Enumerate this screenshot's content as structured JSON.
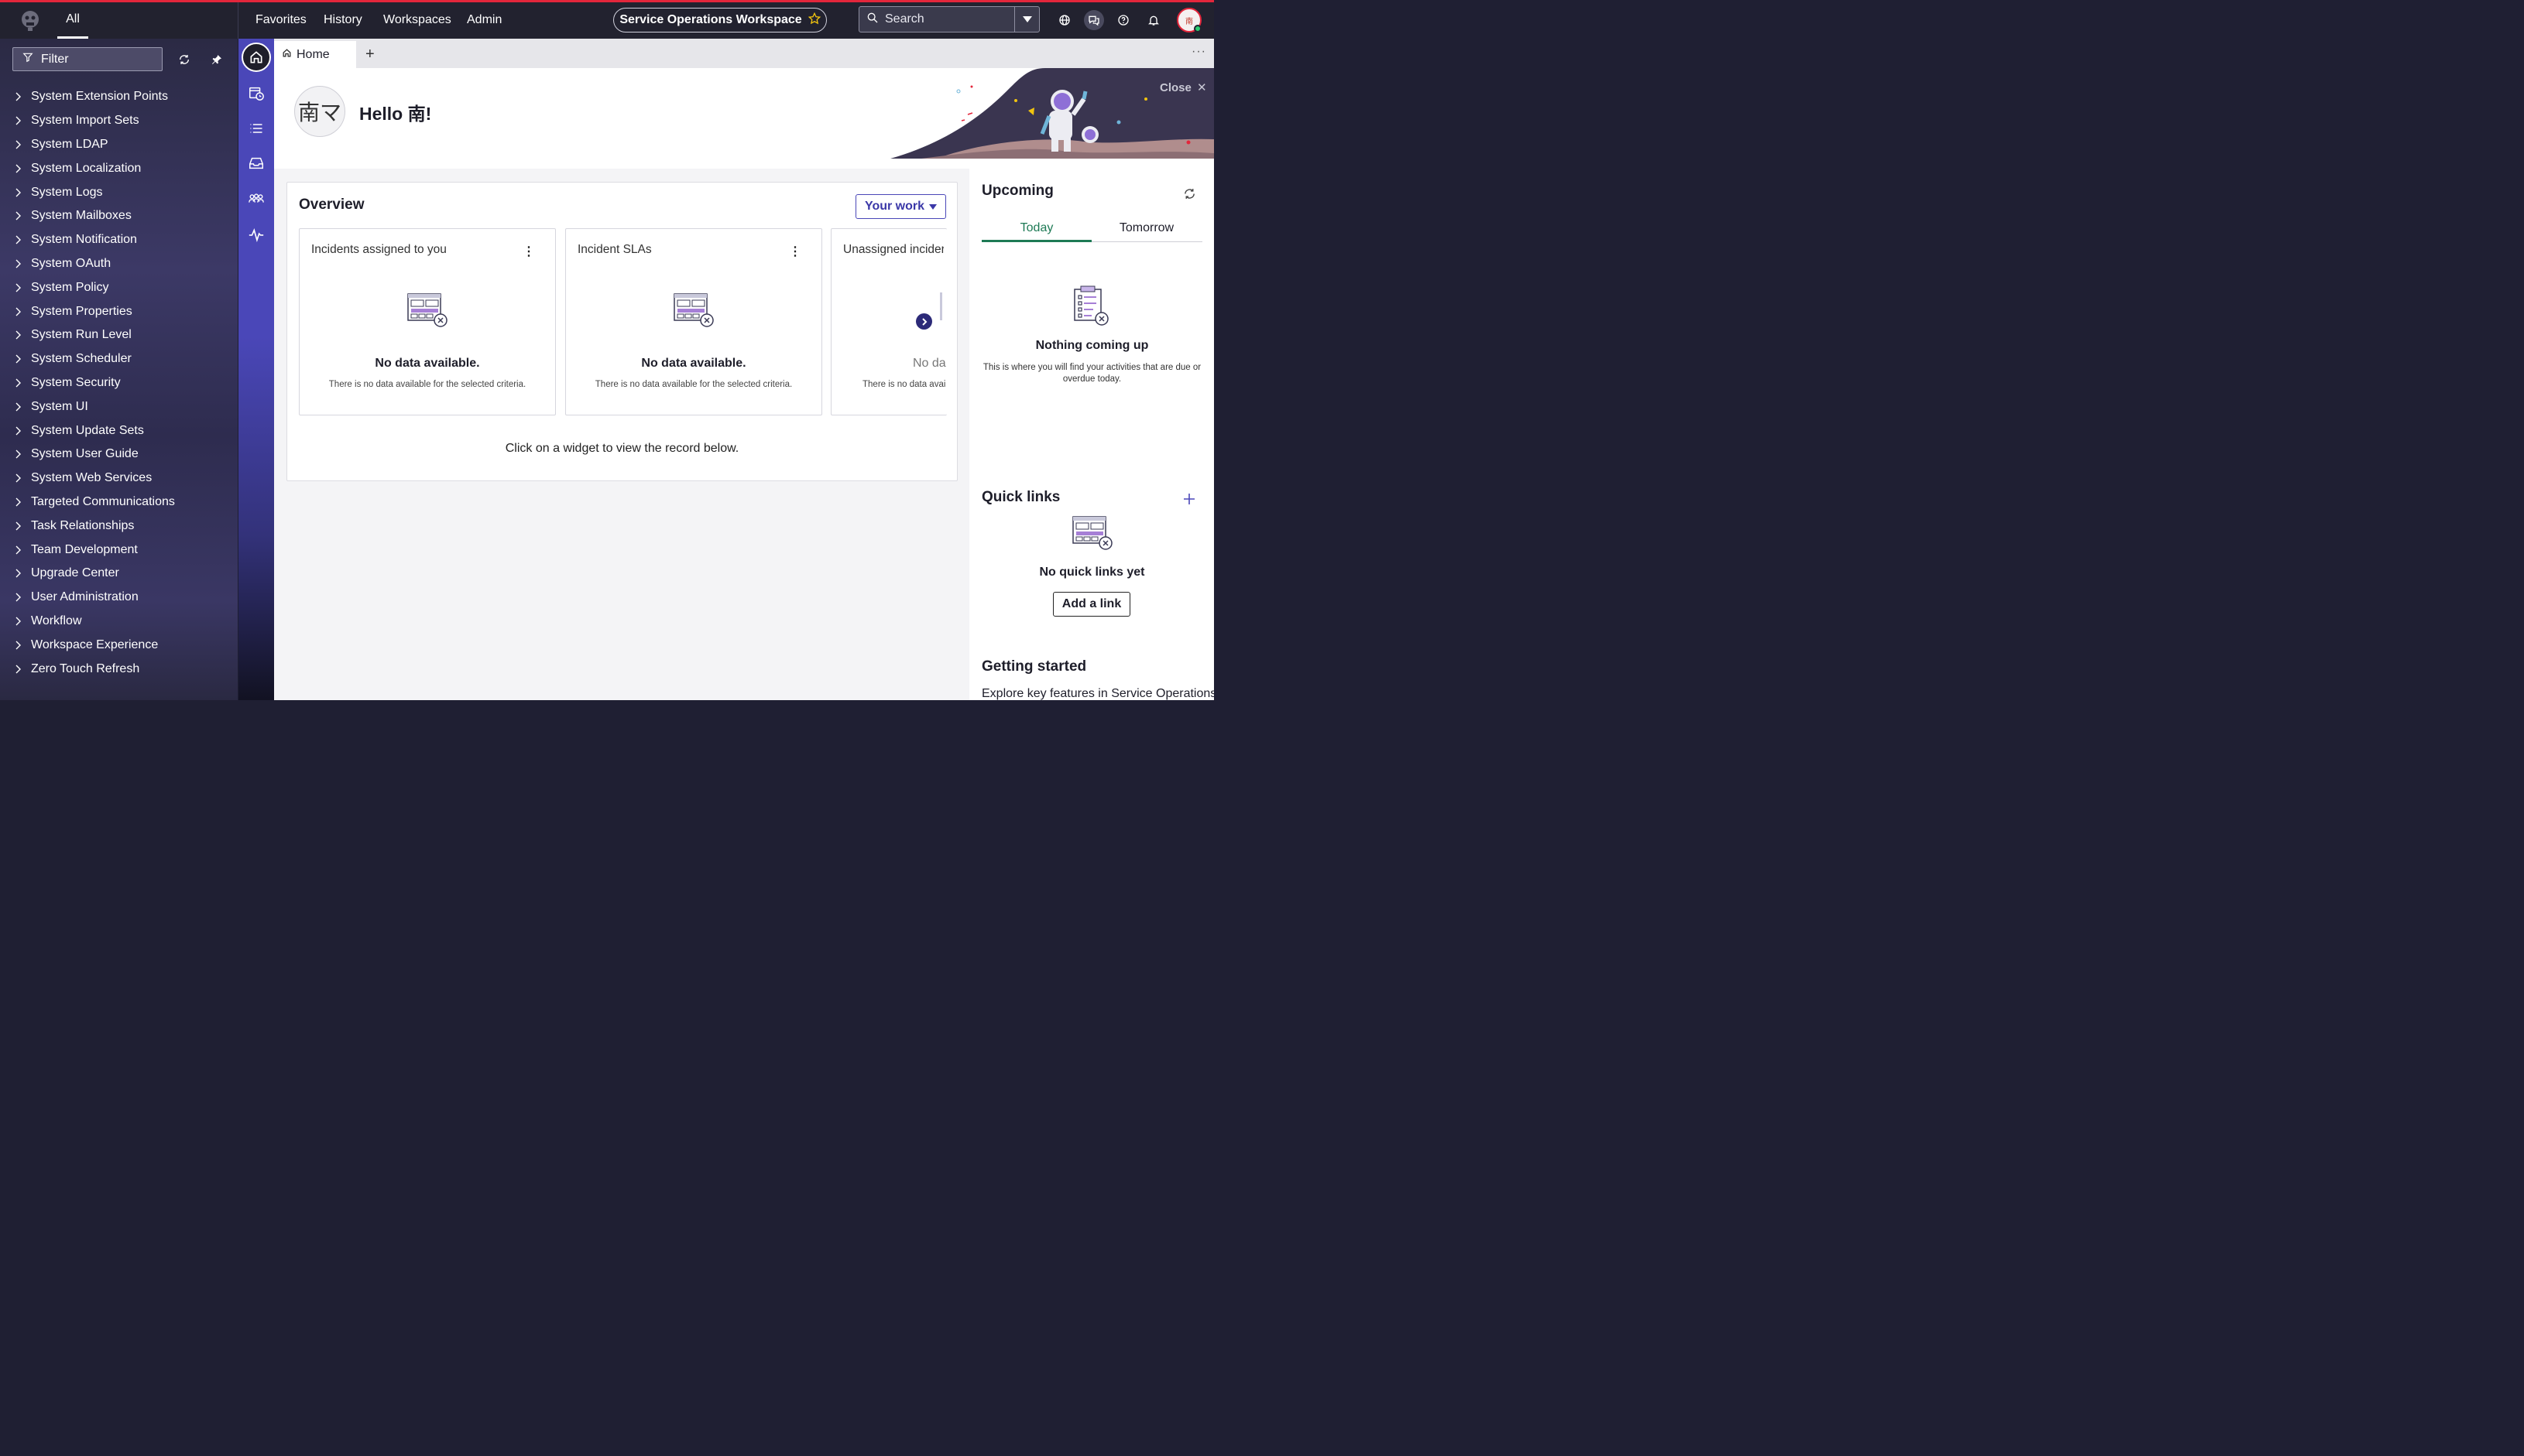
{
  "topbar": {
    "all_label": "All",
    "nav": [
      "Favorites",
      "History",
      "Workspaces",
      "Admin"
    ],
    "workspace_title": "Service Operations Workspace",
    "search_placeholder": "Search",
    "user_initials": "南"
  },
  "leftnav": {
    "filter_label": "Filter",
    "items": [
      "System Extension Points",
      "System Import Sets",
      "System LDAP",
      "System Localization",
      "System Logs",
      "System Mailboxes",
      "System Notification",
      "System OAuth",
      "System Policy",
      "System Properties",
      "System Run Level",
      "System Scheduler",
      "System Security",
      "System UI",
      "System Update Sets",
      "System User Guide",
      "System Web Services",
      "Targeted Communications",
      "Task Relationships",
      "Team Development",
      "Upgrade Center",
      "User Administration",
      "Workflow",
      "Workspace Experience",
      "Zero Touch Refresh"
    ]
  },
  "tabs": {
    "home_label": "Home",
    "add_label": "+",
    "more_label": "···"
  },
  "hello": {
    "avatar_text": "南マ",
    "greeting": "Hello 南!",
    "close_label": "Close"
  },
  "overview": {
    "title": "Overview",
    "filter_button": "Your work",
    "widgets": [
      {
        "title": "Incidents assigned to you",
        "no_data": "No data available.",
        "no_data_sub": "There is no data available for the selected criteria."
      },
      {
        "title": "Incident SLAs",
        "no_data": "No data available.",
        "no_data_sub": "There is no data available for the selected criteria."
      },
      {
        "title": "Unassigned incider",
        "no_data": "No da",
        "no_data_sub": "There is no data avai"
      }
    ],
    "hint": "Click on a widget to view the record below."
  },
  "upcoming": {
    "title": "Upcoming",
    "tabs": [
      "Today",
      "Tomorrow"
    ],
    "empty_title": "Nothing coming up",
    "empty_desc": "This is where you will find your activities that are due or overdue today."
  },
  "quick_links": {
    "title": "Quick links",
    "empty_title": "No quick links yet",
    "add_button": "Add a link"
  },
  "getting_started": {
    "title": "Getting started",
    "desc": "Explore key features in Service Operations"
  },
  "colors": {
    "accent": "#4a47b8",
    "topbar": "#22222f",
    "active_tab": "#1e7a55",
    "brand_red": "#e3263b"
  }
}
